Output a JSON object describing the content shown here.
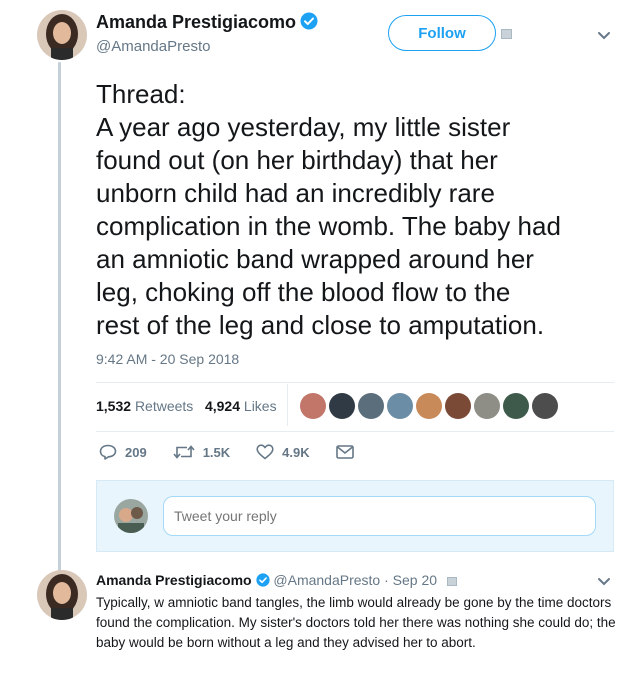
{
  "tweet": {
    "author_name": "Amanda Prestigiacomo",
    "author_handle": "@AmandaPresto",
    "follow_label": "Follow",
    "text_lines": [
      "Thread:",
      "A year ago yesterday, my little sister",
      "found out (on her birthday) that her",
      "unborn child had an incredibly rare",
      "complication in the womb. The baby had",
      "an amniotic band wrapped around her",
      "leg, choking off the blood flow to the",
      "rest of the leg and close to amputation."
    ],
    "timestamp": "9:42 AM - 20 Sep 2018",
    "retweets_count": "1,532",
    "retweets_label": "Retweets",
    "likes_count": "4,924",
    "likes_label": "Likes",
    "actions": {
      "reply_count": "209",
      "retweet_count": "1.5K",
      "like_count": "4.9K"
    }
  },
  "reply_box": {
    "placeholder": "Tweet your reply"
  },
  "reply_tweet": {
    "author_name": "Amanda Prestigiacomo",
    "author_handle": "@AmandaPresto",
    "date": "Sep 20",
    "text": "Typically, w amniotic band tangles, the limb would already be gone by the time doctors found the complication. My sister's doctors told her there was nothing she could do; the baby would be born without a leg and they advised her to abort."
  },
  "colors": {
    "accent": "#1da1f2",
    "secondary_text": "#657786",
    "thread_line": "#c4cfd6"
  },
  "likers": [
    "#c2766a",
    "#2f3a44",
    "#5a6e7c",
    "#6b8ea6",
    "#c98a5a",
    "#7a4a36",
    "#8e8e86",
    "#3e5a4a",
    "#4d4d4d"
  ]
}
